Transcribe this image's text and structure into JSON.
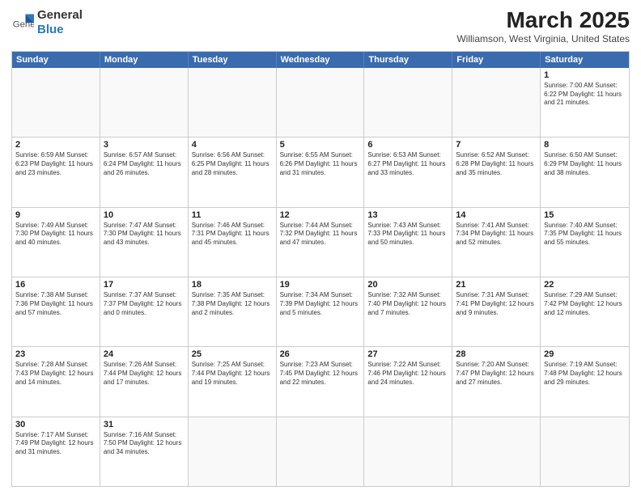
{
  "header": {
    "logo_general": "General",
    "logo_blue": "Blue",
    "month_title": "March 2025",
    "location": "Williamson, West Virginia, United States"
  },
  "weekdays": [
    "Sunday",
    "Monday",
    "Tuesday",
    "Wednesday",
    "Thursday",
    "Friday",
    "Saturday"
  ],
  "rows": [
    [
      {
        "day": "",
        "info": ""
      },
      {
        "day": "",
        "info": ""
      },
      {
        "day": "",
        "info": ""
      },
      {
        "day": "",
        "info": ""
      },
      {
        "day": "",
        "info": ""
      },
      {
        "day": "",
        "info": ""
      },
      {
        "day": "1",
        "info": "Sunrise: 7:00 AM\nSunset: 6:22 PM\nDaylight: 11 hours\nand 21 minutes."
      }
    ],
    [
      {
        "day": "2",
        "info": "Sunrise: 6:59 AM\nSunset: 6:23 PM\nDaylight: 11 hours\nand 23 minutes."
      },
      {
        "day": "3",
        "info": "Sunrise: 6:57 AM\nSunset: 6:24 PM\nDaylight: 11 hours\nand 26 minutes."
      },
      {
        "day": "4",
        "info": "Sunrise: 6:56 AM\nSunset: 6:25 PM\nDaylight: 11 hours\nand 28 minutes."
      },
      {
        "day": "5",
        "info": "Sunrise: 6:55 AM\nSunset: 6:26 PM\nDaylight: 11 hours\nand 31 minutes."
      },
      {
        "day": "6",
        "info": "Sunrise: 6:53 AM\nSunset: 6:27 PM\nDaylight: 11 hours\nand 33 minutes."
      },
      {
        "day": "7",
        "info": "Sunrise: 6:52 AM\nSunset: 6:28 PM\nDaylight: 11 hours\nand 35 minutes."
      },
      {
        "day": "8",
        "info": "Sunrise: 6:50 AM\nSunset: 6:29 PM\nDaylight: 11 hours\nand 38 minutes."
      }
    ],
    [
      {
        "day": "9",
        "info": "Sunrise: 7:49 AM\nSunset: 7:30 PM\nDaylight: 11 hours\nand 40 minutes."
      },
      {
        "day": "10",
        "info": "Sunrise: 7:47 AM\nSunset: 7:30 PM\nDaylight: 11 hours\nand 43 minutes."
      },
      {
        "day": "11",
        "info": "Sunrise: 7:46 AM\nSunset: 7:31 PM\nDaylight: 11 hours\nand 45 minutes."
      },
      {
        "day": "12",
        "info": "Sunrise: 7:44 AM\nSunset: 7:32 PM\nDaylight: 11 hours\nand 47 minutes."
      },
      {
        "day": "13",
        "info": "Sunrise: 7:43 AM\nSunset: 7:33 PM\nDaylight: 11 hours\nand 50 minutes."
      },
      {
        "day": "14",
        "info": "Sunrise: 7:41 AM\nSunset: 7:34 PM\nDaylight: 11 hours\nand 52 minutes."
      },
      {
        "day": "15",
        "info": "Sunrise: 7:40 AM\nSunset: 7:35 PM\nDaylight: 11 hours\nand 55 minutes."
      }
    ],
    [
      {
        "day": "16",
        "info": "Sunrise: 7:38 AM\nSunset: 7:36 PM\nDaylight: 11 hours\nand 57 minutes."
      },
      {
        "day": "17",
        "info": "Sunrise: 7:37 AM\nSunset: 7:37 PM\nDaylight: 12 hours\nand 0 minutes."
      },
      {
        "day": "18",
        "info": "Sunrise: 7:35 AM\nSunset: 7:38 PM\nDaylight: 12 hours\nand 2 minutes."
      },
      {
        "day": "19",
        "info": "Sunrise: 7:34 AM\nSunset: 7:39 PM\nDaylight: 12 hours\nand 5 minutes."
      },
      {
        "day": "20",
        "info": "Sunrise: 7:32 AM\nSunset: 7:40 PM\nDaylight: 12 hours\nand 7 minutes."
      },
      {
        "day": "21",
        "info": "Sunrise: 7:31 AM\nSunset: 7:41 PM\nDaylight: 12 hours\nand 9 minutes."
      },
      {
        "day": "22",
        "info": "Sunrise: 7:29 AM\nSunset: 7:42 PM\nDaylight: 12 hours\nand 12 minutes."
      }
    ],
    [
      {
        "day": "23",
        "info": "Sunrise: 7:28 AM\nSunset: 7:43 PM\nDaylight: 12 hours\nand 14 minutes."
      },
      {
        "day": "24",
        "info": "Sunrise: 7:26 AM\nSunset: 7:44 PM\nDaylight: 12 hours\nand 17 minutes."
      },
      {
        "day": "25",
        "info": "Sunrise: 7:25 AM\nSunset: 7:44 PM\nDaylight: 12 hours\nand 19 minutes."
      },
      {
        "day": "26",
        "info": "Sunrise: 7:23 AM\nSunset: 7:45 PM\nDaylight: 12 hours\nand 22 minutes."
      },
      {
        "day": "27",
        "info": "Sunrise: 7:22 AM\nSunset: 7:46 PM\nDaylight: 12 hours\nand 24 minutes."
      },
      {
        "day": "28",
        "info": "Sunrise: 7:20 AM\nSunset: 7:47 PM\nDaylight: 12 hours\nand 27 minutes."
      },
      {
        "day": "29",
        "info": "Sunrise: 7:19 AM\nSunset: 7:48 PM\nDaylight: 12 hours\nand 29 minutes."
      }
    ],
    [
      {
        "day": "30",
        "info": "Sunrise: 7:17 AM\nSunset: 7:49 PM\nDaylight: 12 hours\nand 31 minutes."
      },
      {
        "day": "31",
        "info": "Sunrise: 7:16 AM\nSunset: 7:50 PM\nDaylight: 12 hours\nand 34 minutes."
      },
      {
        "day": "",
        "info": ""
      },
      {
        "day": "",
        "info": ""
      },
      {
        "day": "",
        "info": ""
      },
      {
        "day": "",
        "info": ""
      },
      {
        "day": "",
        "info": ""
      }
    ]
  ]
}
